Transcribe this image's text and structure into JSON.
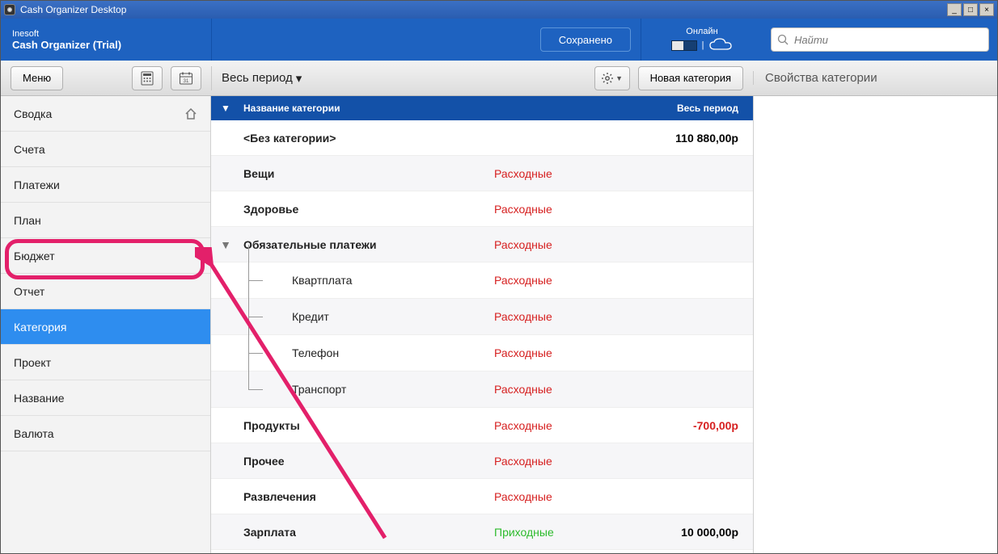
{
  "window_title": "Cash Organizer Desktop",
  "brand": {
    "company": "Inesoft",
    "product": "Cash Organizer (Trial)"
  },
  "header": {
    "saved_label": "Сохранено",
    "online_label": "Онлайн",
    "search_placeholder": "Найти"
  },
  "toolbar": {
    "menu_label": "Меню",
    "period_label": "Весь период",
    "new_category_label": "Новая категория",
    "details_title": "Свойства категории"
  },
  "sidebar": {
    "items": [
      {
        "label": "Сводка",
        "icon": "home"
      },
      {
        "label": "Счета"
      },
      {
        "label": "Платежи"
      },
      {
        "label": "План"
      },
      {
        "label": "Бюджет"
      },
      {
        "label": "Отчет"
      },
      {
        "label": "Категория",
        "active": true
      },
      {
        "label": "Проект"
      },
      {
        "label": "Название"
      },
      {
        "label": "Валюта"
      }
    ]
  },
  "table": {
    "columns": {
      "name": "Название категории",
      "period": "Весь период"
    },
    "rows": [
      {
        "name": "<Без категории>",
        "type": "",
        "amount": "110 880,00р"
      },
      {
        "name": "Вещи",
        "type": "Расходные",
        "type_class": "expense"
      },
      {
        "name": "Здоровье",
        "type": "Расходные",
        "type_class": "expense"
      },
      {
        "name": "Обязательные платежи",
        "type": "Расходные",
        "type_class": "expense",
        "expandable": true,
        "expanded": true
      },
      {
        "name": "Квартплата",
        "type": "Расходные",
        "type_class": "expense",
        "child": true,
        "cont": true
      },
      {
        "name": "Кредит",
        "type": "Расходные",
        "type_class": "expense",
        "child": true,
        "cont": true
      },
      {
        "name": "Телефон",
        "type": "Расходные",
        "type_class": "expense",
        "child": true,
        "cont": true
      },
      {
        "name": "Транспорт",
        "type": "Расходные",
        "type_class": "expense",
        "child": true
      },
      {
        "name": "Продукты",
        "type": "Расходные",
        "type_class": "expense",
        "amount": "-700,00р",
        "amount_class": "neg"
      },
      {
        "name": "Прочее",
        "type": "Расходные",
        "type_class": "expense"
      },
      {
        "name": "Развлечения",
        "type": "Расходные",
        "type_class": "expense"
      },
      {
        "name": "Зарплата",
        "type": "Приходные",
        "type_class": "income",
        "amount": "10 000,00р"
      }
    ]
  }
}
